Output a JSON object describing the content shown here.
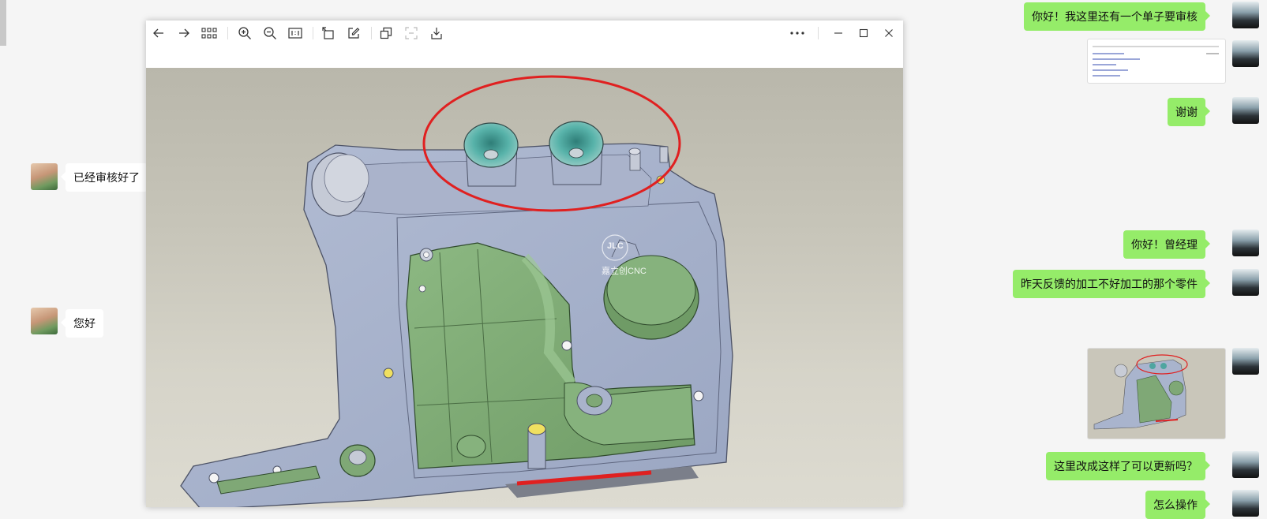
{
  "left_messages": [
    {
      "text": "已经审核好了"
    },
    {
      "text": "您好"
    }
  ],
  "right_messages": [
    {
      "text": "你好！我这里还有一个单子要审核"
    },
    {
      "text": "谢谢"
    },
    {
      "text": "你好！曾经理"
    },
    {
      "text": "昨天反馈的加工不好加工的那个零件"
    },
    {
      "text": "这里改成这样了可以更新吗？"
    },
    {
      "text": "怎么操作"
    }
  ],
  "viewer": {
    "watermark_logo": "JLC",
    "watermark_text": "嘉立创CNC",
    "toolbar_icons": [
      "back-arrow-icon",
      "forward-arrow-icon",
      "grid-view-icon",
      "zoom-in-icon",
      "zoom-out-icon",
      "actual-size-icon",
      "rotate-icon",
      "edit-icon",
      "copy-icon",
      "ocr-icon",
      "download-icon",
      "more-icon",
      "minimize-icon",
      "maximize-icon",
      "close-icon"
    ]
  },
  "colors": {
    "sent_bubble": "#95ec69",
    "received_bubble": "#ffffff",
    "annotation_red": "#e02020",
    "part_green": "#7fa876",
    "part_blue_gray": "#a9b4cd"
  }
}
